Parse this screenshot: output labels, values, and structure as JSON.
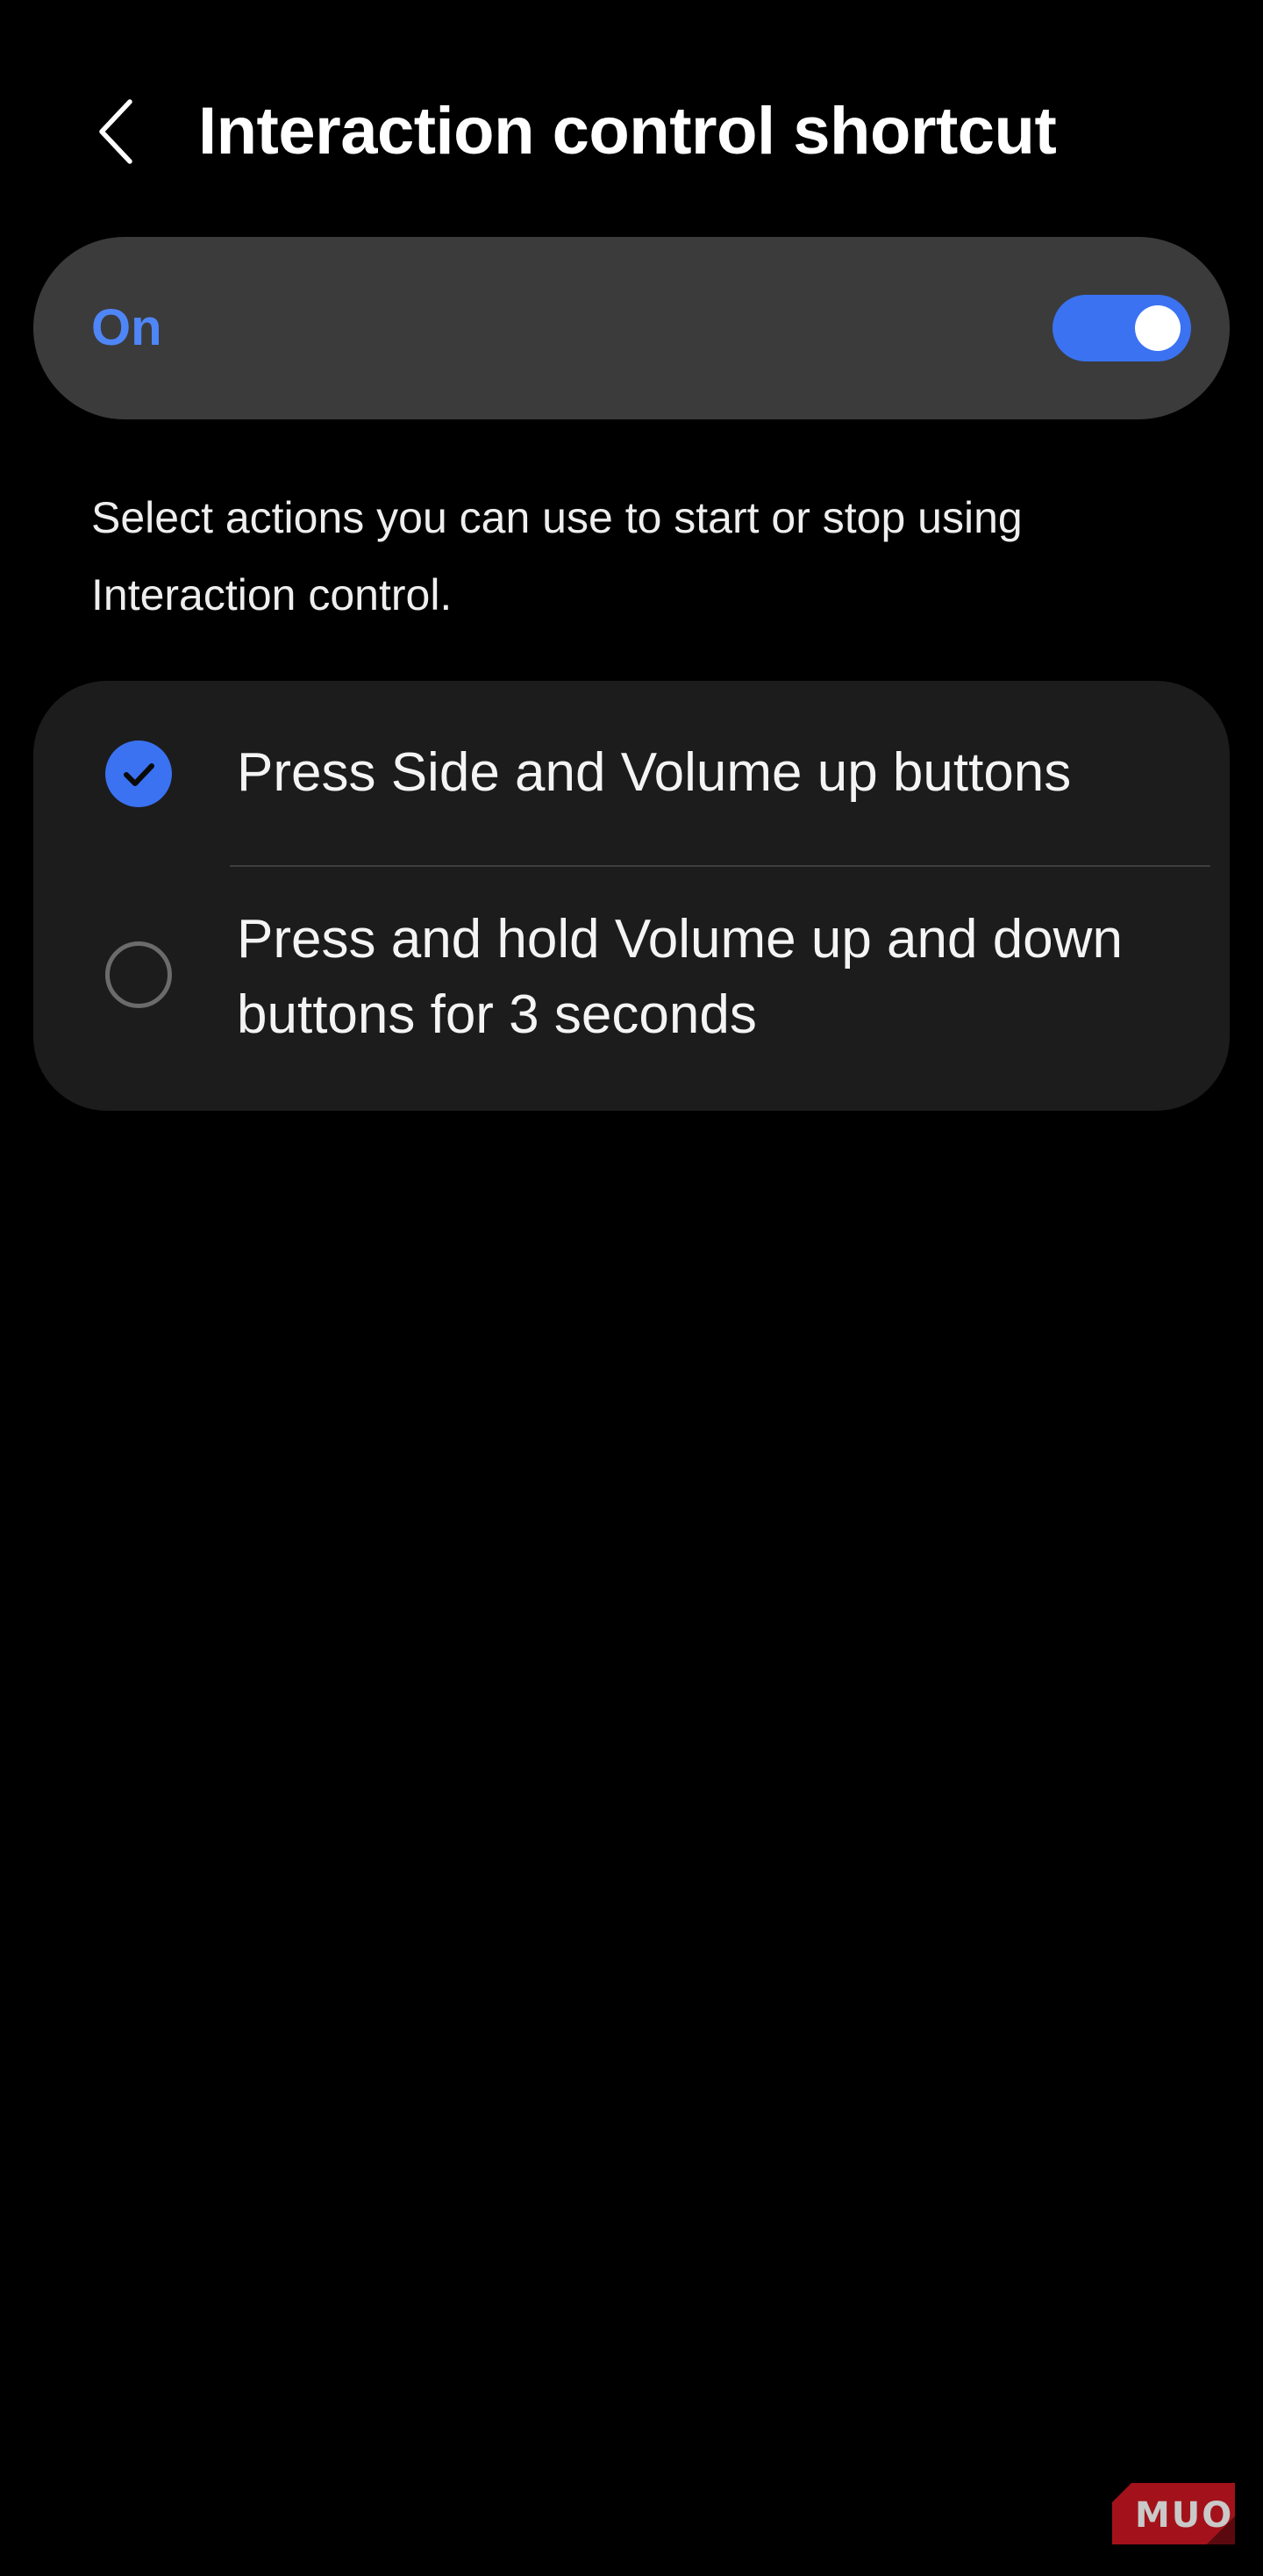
{
  "header": {
    "back_icon": "chevron-left-icon",
    "title": "Interaction control shortcut"
  },
  "master_switch": {
    "label": "On",
    "state": true,
    "accent_color": "#3a72f2"
  },
  "description": "Select actions you can use to start or stop using Interaction control.",
  "options": [
    {
      "label": "Press Side and Volume up buttons",
      "checked": true
    },
    {
      "label": "Press and hold Volume up and down buttons for 3 seconds",
      "checked": false
    }
  ],
  "watermark": {
    "text": "MUO",
    "color": "#c0141c"
  },
  "colors": {
    "background": "#000000",
    "card": "#3b3b3b",
    "list_card": "#1c1c1c",
    "accent_text": "#4f86f7"
  }
}
